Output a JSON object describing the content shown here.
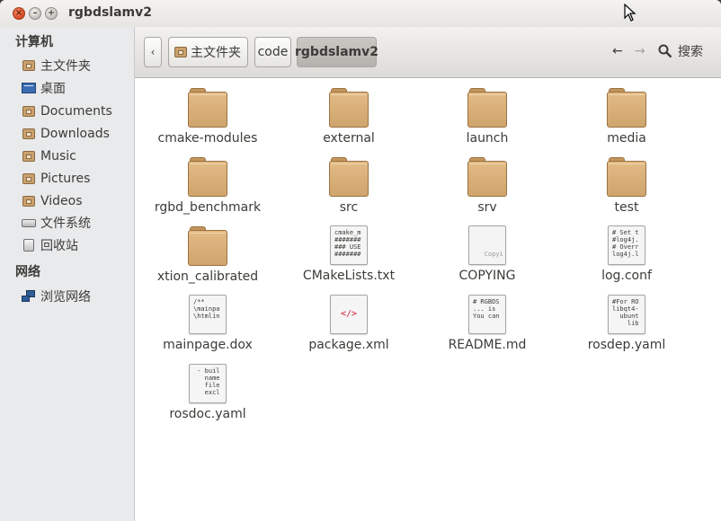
{
  "window": {
    "title": "rgbdslamv2",
    "controls": {
      "close": "×",
      "minimize": "–",
      "maximize": "+"
    }
  },
  "sidebar": {
    "computer_heading": "计算机",
    "computer_items": [
      {
        "label": "主文件夹",
        "icon": "home-folder-icon"
      },
      {
        "label": "桌面",
        "icon": "desktop-icon"
      },
      {
        "label": "Documents",
        "icon": "documents-folder-icon"
      },
      {
        "label": "Downloads",
        "icon": "downloads-folder-icon"
      },
      {
        "label": "Music",
        "icon": "music-folder-icon"
      },
      {
        "label": "Pictures",
        "icon": "pictures-folder-icon"
      },
      {
        "label": "Videos",
        "icon": "videos-folder-icon"
      },
      {
        "label": "文件系统",
        "icon": "filesystem-icon"
      },
      {
        "label": "回收站",
        "icon": "trash-icon"
      }
    ],
    "network_heading": "网络",
    "network_items": [
      {
        "label": "浏览网络",
        "icon": "network-icon"
      }
    ]
  },
  "toolbar": {
    "back_toggle": "‹",
    "breadcrumbs": [
      "主文件夹",
      "code",
      "rgbdslamv2"
    ],
    "search_label": "搜索",
    "back_arrow": "←",
    "forward_arrow": "→"
  },
  "files": [
    {
      "name": "cmake-modules",
      "type": "folder"
    },
    {
      "name": "external",
      "type": "folder"
    },
    {
      "name": "launch",
      "type": "folder"
    },
    {
      "name": "media",
      "type": "folder"
    },
    {
      "name": "rgbd_benchmark",
      "type": "folder"
    },
    {
      "name": "src",
      "type": "folder"
    },
    {
      "name": "srv",
      "type": "folder"
    },
    {
      "name": "test",
      "type": "folder"
    },
    {
      "name": "xtion_calibrated",
      "type": "folder"
    },
    {
      "name": "CMakeLists.txt",
      "type": "text",
      "preview": "cmake_m\n#######\n### USE\n#######"
    },
    {
      "name": "COPYING",
      "type": "text",
      "preview": "\n\n\n   Copyi"
    },
    {
      "name": "log.conf",
      "type": "text",
      "preview": "# Set t\n#log4j.\n# Overr\nlog4j.l"
    },
    {
      "name": "mainpage.dox",
      "type": "text",
      "preview": "/**\n\\mainpa\n\\htmlin"
    },
    {
      "name": "package.xml",
      "type": "xml",
      "preview": "</>"
    },
    {
      "name": "README.md",
      "type": "text",
      "preview": "# RGBDS\n... is \nYou can"
    },
    {
      "name": "rosdep.yaml",
      "type": "text",
      "preview": "#For RO\nlibqt4-\n  ubunt\n    lib"
    },
    {
      "name": "rosdoc.yaml",
      "type": "text",
      "preview": " - buil\n   name\n   file\n   excl"
    }
  ]
}
